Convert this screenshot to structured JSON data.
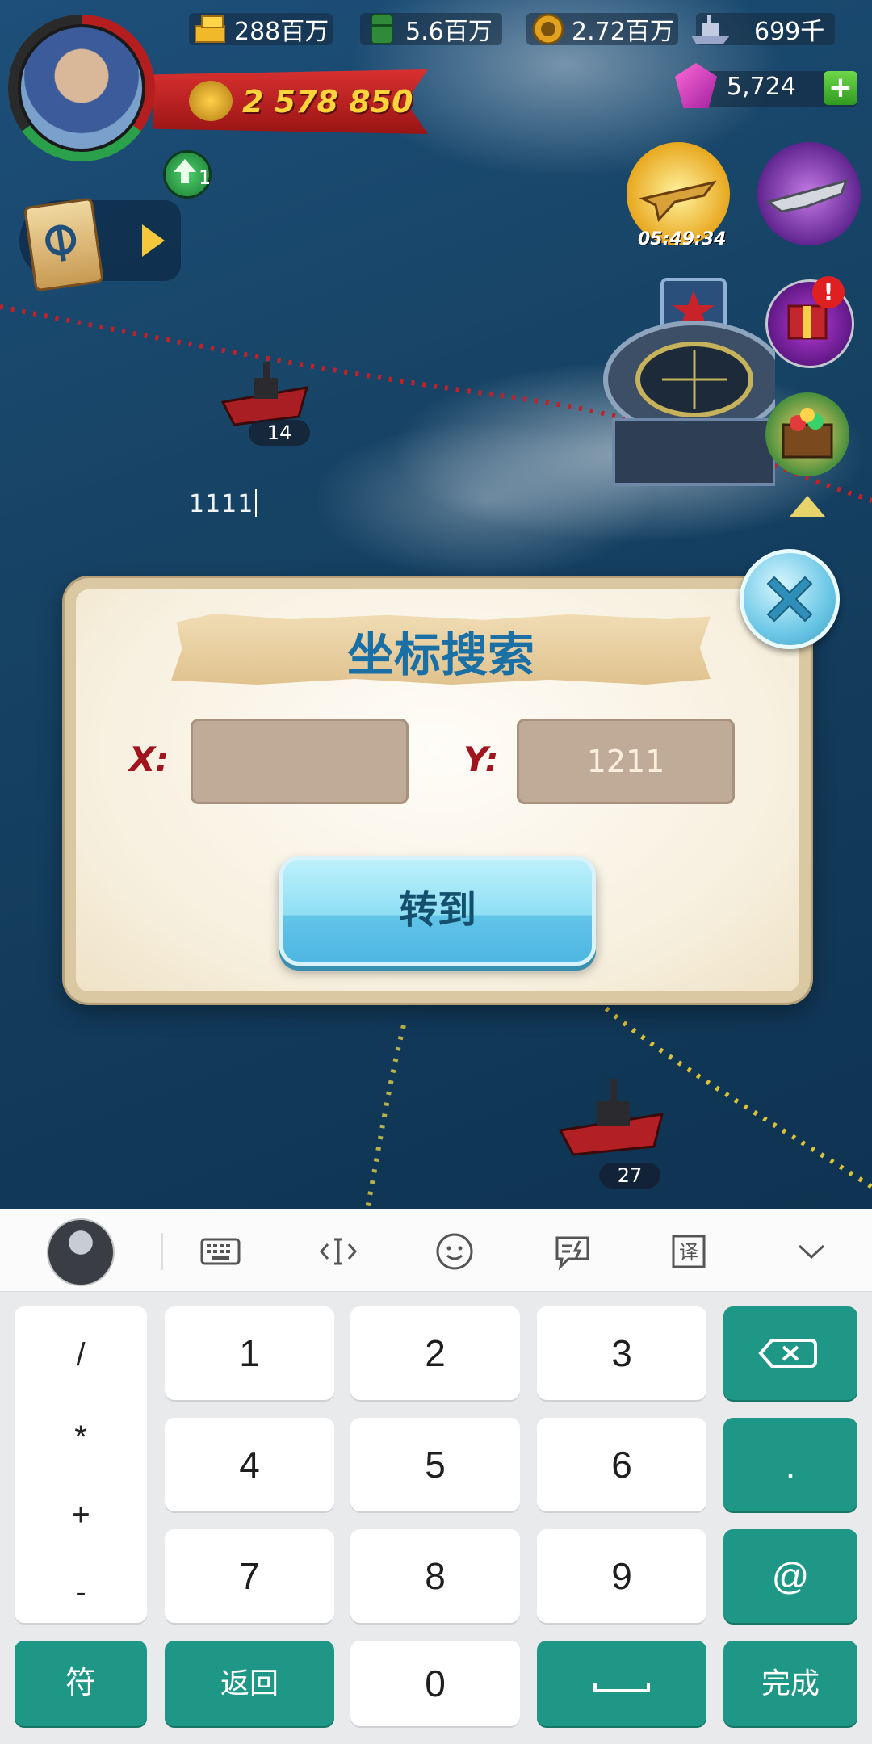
{
  "resources": [
    {
      "name": "gold",
      "value": "288百万",
      "icon": "gold-bars-icon"
    },
    {
      "name": "oil",
      "value": "5.6百万",
      "icon": "oil-barrel-icon"
    },
    {
      "name": "steel",
      "value": "2.72百万",
      "icon": "steel-coin-icon"
    },
    {
      "name": "fleet",
      "value": "699千",
      "icon": "warship-icon"
    }
  ],
  "player": {
    "score": "2 578 850",
    "upgrade_count": "1"
  },
  "gems": {
    "value": "5,724",
    "plus": "+"
  },
  "event": {
    "timer": "05:49:34"
  },
  "alert": {
    "symbol": "!"
  },
  "ships": [
    {
      "level": "14"
    },
    {
      "level": "27"
    }
  ],
  "typed_text": "1111",
  "dialog": {
    "title": "坐标搜索",
    "x_label": "X:",
    "x_value": "",
    "y_label": "Y:",
    "y_value": "1211",
    "go_label": "转到"
  },
  "keyboard": {
    "symbols": [
      "/",
      "*",
      "+",
      "-"
    ],
    "digits": [
      "1",
      "2",
      "3",
      "4",
      "5",
      "6",
      "7",
      "8",
      "9"
    ],
    "zero": "0",
    "dot": ".",
    "at": "@",
    "sym_key": "符",
    "back_key": "返回",
    "done_key": "完成"
  }
}
